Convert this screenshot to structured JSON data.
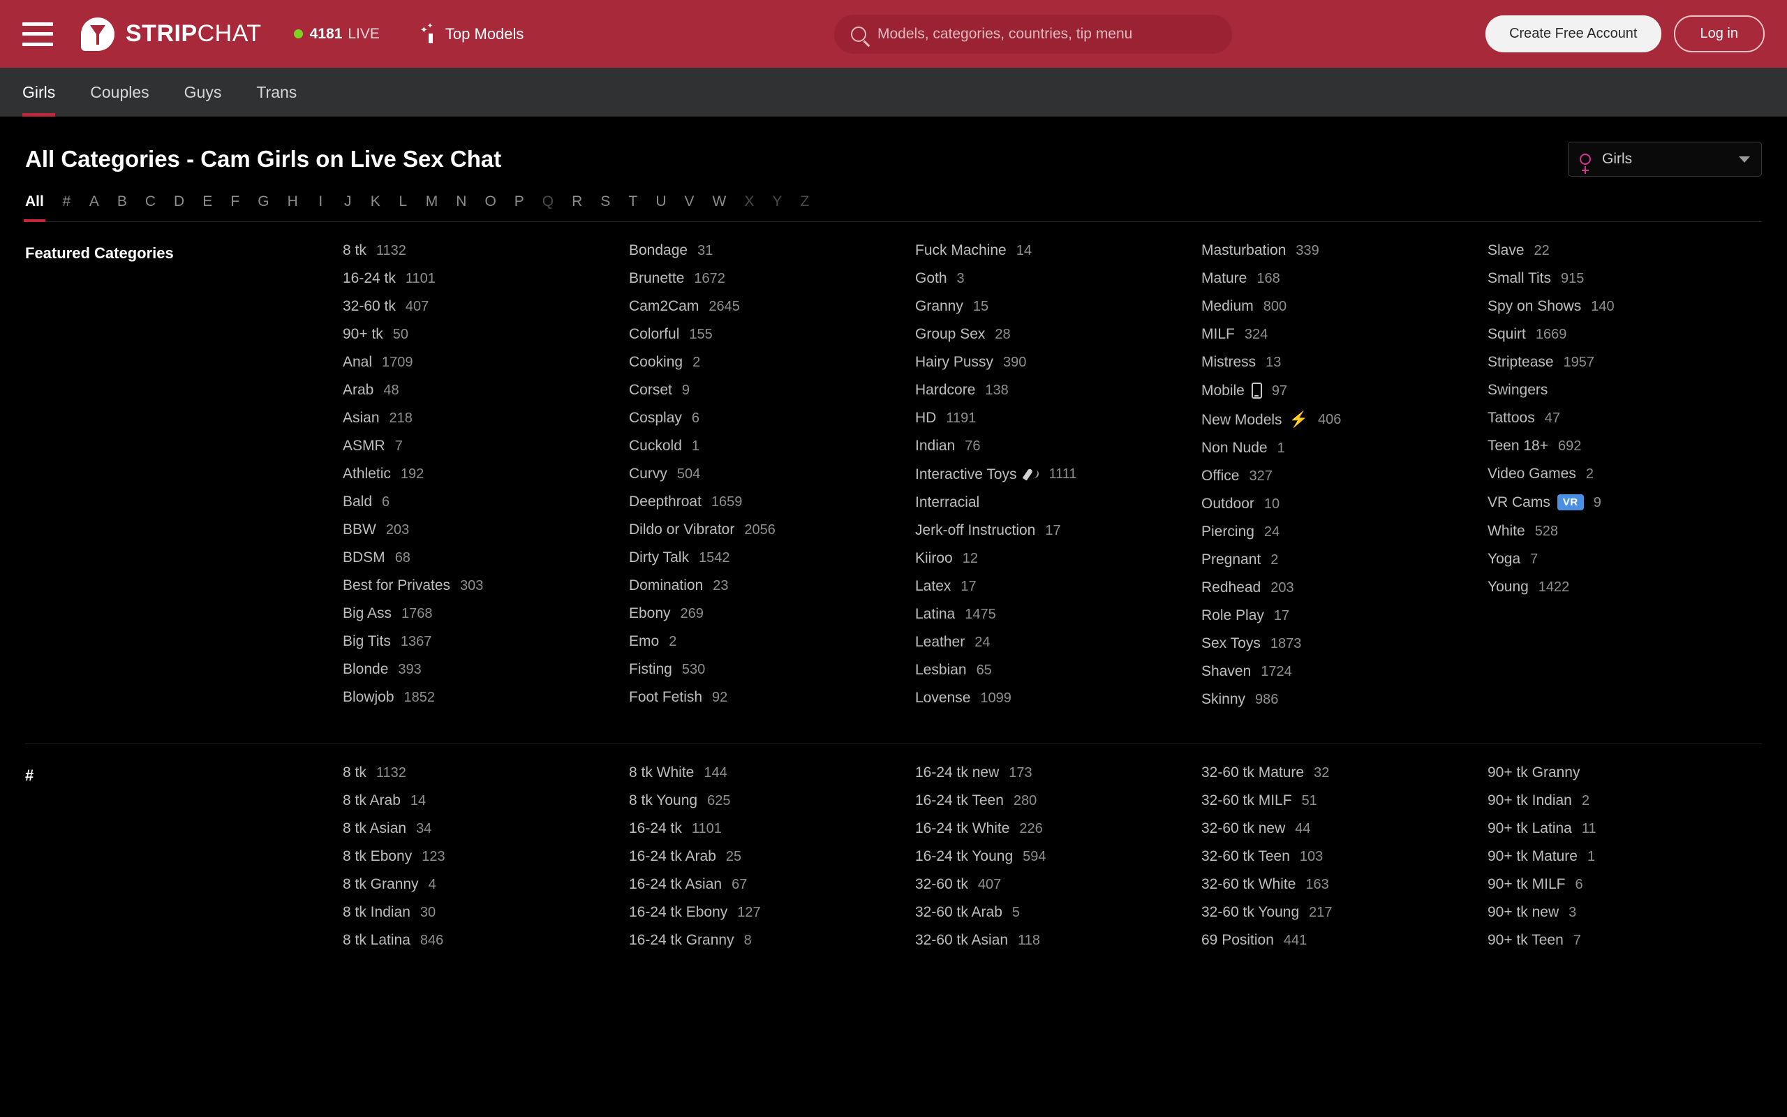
{
  "header": {
    "menu_icon": "hamburger-icon",
    "logo_strong": "STRIP",
    "logo_light": "CHAT",
    "live_count": "4181",
    "live_label": "LIVE",
    "top_models_label": "Top Models",
    "search_placeholder": "Models, categories, countries, tip menu",
    "create_account_label": "Create Free Account",
    "login_label": "Log in",
    "brand_color": "#a8293a",
    "live_dot_color": "#7ed321"
  },
  "gender_nav": {
    "items": [
      {
        "label": "Girls",
        "active": true
      },
      {
        "label": "Couples",
        "active": false
      },
      {
        "label": "Guys",
        "active": false
      },
      {
        "label": "Trans",
        "active": false
      }
    ],
    "active_underline_color": "#c1273b"
  },
  "page": {
    "title": "All Categories - Cam Girls on Live Sex Chat",
    "gender_select": {
      "value": "Girls",
      "icon": "venus-icon",
      "icon_color": "#d6348f",
      "caret": "chevron-down-icon"
    }
  },
  "alphabet": {
    "items": [
      {
        "label": "All",
        "active": true,
        "disabled": false
      },
      {
        "label": "#",
        "active": false,
        "disabled": false
      },
      {
        "label": "A",
        "active": false,
        "disabled": false
      },
      {
        "label": "B",
        "active": false,
        "disabled": false
      },
      {
        "label": "C",
        "active": false,
        "disabled": false
      },
      {
        "label": "D",
        "active": false,
        "disabled": false
      },
      {
        "label": "E",
        "active": false,
        "disabled": false
      },
      {
        "label": "F",
        "active": false,
        "disabled": false
      },
      {
        "label": "G",
        "active": false,
        "disabled": false
      },
      {
        "label": "H",
        "active": false,
        "disabled": false
      },
      {
        "label": "I",
        "active": false,
        "disabled": false
      },
      {
        "label": "J",
        "active": false,
        "disabled": false
      },
      {
        "label": "K",
        "active": false,
        "disabled": false
      },
      {
        "label": "L",
        "active": false,
        "disabled": false
      },
      {
        "label": "M",
        "active": false,
        "disabled": false
      },
      {
        "label": "N",
        "active": false,
        "disabled": false
      },
      {
        "label": "O",
        "active": false,
        "disabled": false
      },
      {
        "label": "P",
        "active": false,
        "disabled": false
      },
      {
        "label": "Q",
        "active": false,
        "disabled": true
      },
      {
        "label": "R",
        "active": false,
        "disabled": false
      },
      {
        "label": "S",
        "active": false,
        "disabled": false
      },
      {
        "label": "T",
        "active": false,
        "disabled": false
      },
      {
        "label": "U",
        "active": false,
        "disabled": false
      },
      {
        "label": "V",
        "active": false,
        "disabled": false
      },
      {
        "label": "W",
        "active": false,
        "disabled": false
      },
      {
        "label": "X",
        "active": false,
        "disabled": true
      },
      {
        "label": "Y",
        "active": false,
        "disabled": true
      },
      {
        "label": "Z",
        "active": false,
        "disabled": true
      }
    ]
  },
  "sections": [
    {
      "label": "Featured Categories",
      "columns": [
        [
          {
            "name": "8 tk",
            "count": "1132"
          },
          {
            "name": "16-24 tk",
            "count": "1101"
          },
          {
            "name": "32-60 tk",
            "count": "407"
          },
          {
            "name": "90+ tk",
            "count": "50"
          },
          {
            "name": "Anal",
            "count": "1709"
          },
          {
            "name": "Arab",
            "count": "48"
          },
          {
            "name": "Asian",
            "count": "218"
          },
          {
            "name": "ASMR",
            "count": "7"
          },
          {
            "name": "Athletic",
            "count": "192"
          },
          {
            "name": "Bald",
            "count": "6"
          },
          {
            "name": "BBW",
            "count": "203"
          },
          {
            "name": "BDSM",
            "count": "68"
          },
          {
            "name": "Best for Privates",
            "count": "303"
          },
          {
            "name": "Big Ass",
            "count": "1768"
          },
          {
            "name": "Big Tits",
            "count": "1367"
          },
          {
            "name": "Blonde",
            "count": "393"
          },
          {
            "name": "Blowjob",
            "count": "1852"
          }
        ],
        [
          {
            "name": "Bondage",
            "count": "31"
          },
          {
            "name": "Brunette",
            "count": "1672"
          },
          {
            "name": "Cam2Cam",
            "count": "2645"
          },
          {
            "name": "Colorful",
            "count": "155"
          },
          {
            "name": "Cooking",
            "count": "2"
          },
          {
            "name": "Corset",
            "count": "9"
          },
          {
            "name": "Cosplay",
            "count": "6"
          },
          {
            "name": "Cuckold",
            "count": "1"
          },
          {
            "name": "Curvy",
            "count": "504"
          },
          {
            "name": "Deepthroat",
            "count": "1659"
          },
          {
            "name": "Dildo or Vibrator",
            "count": "2056"
          },
          {
            "name": "Dirty Talk",
            "count": "1542"
          },
          {
            "name": "Domination",
            "count": "23"
          },
          {
            "name": "Ebony",
            "count": "269"
          },
          {
            "name": "Emo",
            "count": "2"
          },
          {
            "name": "Fisting",
            "count": "530"
          },
          {
            "name": "Foot Fetish",
            "count": "92"
          }
        ],
        [
          {
            "name": "Fuck Machine",
            "count": "14"
          },
          {
            "name": "Goth",
            "count": "3"
          },
          {
            "name": "Granny",
            "count": "15"
          },
          {
            "name": "Group Sex",
            "count": "28"
          },
          {
            "name": "Hairy Pussy",
            "count": "390"
          },
          {
            "name": "Hardcore",
            "count": "138"
          },
          {
            "name": "HD",
            "count": "1191"
          },
          {
            "name": "Indian",
            "count": "76"
          },
          {
            "name": "Interactive Toys",
            "count": "1111",
            "icon": "interactive-toy-icon"
          },
          {
            "name": "Interracial",
            "count": ""
          },
          {
            "name": "Jerk-off Instruction",
            "count": "17"
          },
          {
            "name": "Kiiroo",
            "count": "12"
          },
          {
            "name": "Latex",
            "count": "17"
          },
          {
            "name": "Latina",
            "count": "1475"
          },
          {
            "name": "Leather",
            "count": "24"
          },
          {
            "name": "Lesbian",
            "count": "65"
          },
          {
            "name": "Lovense",
            "count": "1099"
          }
        ],
        [
          {
            "name": "Masturbation",
            "count": "339"
          },
          {
            "name": "Mature",
            "count": "168"
          },
          {
            "name": "Medium",
            "count": "800"
          },
          {
            "name": "MILF",
            "count": "324"
          },
          {
            "name": "Mistress",
            "count": "13"
          },
          {
            "name": "Mobile",
            "count": "97",
            "icon": "mobile-phone-icon"
          },
          {
            "name": "New Models",
            "count": "406",
            "icon": "lightning-bolt-icon"
          },
          {
            "name": "Non Nude",
            "count": "1"
          },
          {
            "name": "Office",
            "count": "327"
          },
          {
            "name": "Outdoor",
            "count": "10"
          },
          {
            "name": "Piercing",
            "count": "24"
          },
          {
            "name": "Pregnant",
            "count": "2"
          },
          {
            "name": "Redhead",
            "count": "203"
          },
          {
            "name": "Role Play",
            "count": "17"
          },
          {
            "name": "Sex Toys",
            "count": "1873"
          },
          {
            "name": "Shaven",
            "count": "1724"
          },
          {
            "name": "Skinny",
            "count": "986"
          }
        ],
        [
          {
            "name": "Slave",
            "count": "22"
          },
          {
            "name": "Small Tits",
            "count": "915"
          },
          {
            "name": "Spy on Shows",
            "count": "140"
          },
          {
            "name": "Squirt",
            "count": "1669"
          },
          {
            "name": "Striptease",
            "count": "1957"
          },
          {
            "name": "Swingers",
            "count": ""
          },
          {
            "name": "Tattoos",
            "count": "47"
          },
          {
            "name": "Teen 18+",
            "count": "692"
          },
          {
            "name": "Video Games",
            "count": "2"
          },
          {
            "name": "VR Cams",
            "count": "9",
            "badge": "VR",
            "badge_color": "#4a90e2"
          },
          {
            "name": "White",
            "count": "528"
          },
          {
            "name": "Yoga",
            "count": "7"
          },
          {
            "name": "Young",
            "count": "1422"
          }
        ]
      ]
    },
    {
      "label": "#",
      "columns": [
        [
          {
            "name": "8 tk",
            "count": "1132"
          },
          {
            "name": "8 tk Arab",
            "count": "14"
          },
          {
            "name": "8 tk Asian",
            "count": "34"
          },
          {
            "name": "8 tk Ebony",
            "count": "123"
          },
          {
            "name": "8 tk Granny",
            "count": "4"
          },
          {
            "name": "8 tk Indian",
            "count": "30"
          },
          {
            "name": "8 tk Latina",
            "count": "846"
          }
        ],
        [
          {
            "name": "8 tk White",
            "count": "144"
          },
          {
            "name": "8 tk Young",
            "count": "625"
          },
          {
            "name": "16-24 tk",
            "count": "1101"
          },
          {
            "name": "16-24 tk Arab",
            "count": "25"
          },
          {
            "name": "16-24 tk Asian",
            "count": "67"
          },
          {
            "name": "16-24 tk Ebony",
            "count": "127"
          },
          {
            "name": "16-24 tk Granny",
            "count": "8"
          }
        ],
        [
          {
            "name": "16-24 tk new",
            "count": "173"
          },
          {
            "name": "16-24 tk Teen",
            "count": "280"
          },
          {
            "name": "16-24 tk White",
            "count": "226"
          },
          {
            "name": "16-24 tk Young",
            "count": "594"
          },
          {
            "name": "32-60 tk",
            "count": "407"
          },
          {
            "name": "32-60 tk Arab",
            "count": "5"
          },
          {
            "name": "32-60 tk Asian",
            "count": "118"
          }
        ],
        [
          {
            "name": "32-60 tk Mature",
            "count": "32"
          },
          {
            "name": "32-60 tk MILF",
            "count": "51"
          },
          {
            "name": "32-60 tk new",
            "count": "44"
          },
          {
            "name": "32-60 tk Teen",
            "count": "103"
          },
          {
            "name": "32-60 tk White",
            "count": "163"
          },
          {
            "name": "32-60 tk Young",
            "count": "217"
          },
          {
            "name": "69 Position",
            "count": "441"
          }
        ],
        [
          {
            "name": "90+ tk Granny",
            "count": ""
          },
          {
            "name": "90+ tk Indian",
            "count": "2"
          },
          {
            "name": "90+ tk Latina",
            "count": "11"
          },
          {
            "name": "90+ tk Mature",
            "count": "1"
          },
          {
            "name": "90+ tk MILF",
            "count": "6"
          },
          {
            "name": "90+ tk new",
            "count": "3"
          },
          {
            "name": "90+ tk Teen",
            "count": "7"
          }
        ]
      ]
    }
  ]
}
